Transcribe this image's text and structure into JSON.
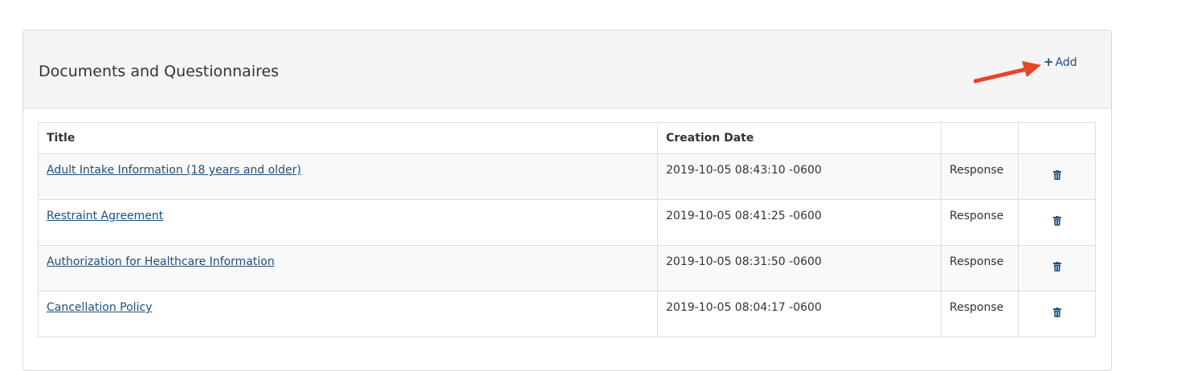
{
  "panel": {
    "title": "Documents and Questionnaires",
    "add_label": "Add",
    "add_icon": "plus-icon",
    "annotation_arrow_color": "#e8442a"
  },
  "table": {
    "columns": [
      "Title",
      "Creation Date",
      "",
      ""
    ],
    "rows": [
      {
        "title": "Adult Intake Information (18 years and older)",
        "date": "2019-10-05 08:43:10 -0600",
        "action": "Response",
        "delete_icon": "trash-icon"
      },
      {
        "title": "Restraint Agreement",
        "date": "2019-10-05 08:41:25 -0600",
        "action": "Response",
        "delete_icon": "trash-icon"
      },
      {
        "title": "Authorization for Healthcare Information",
        "date": "2019-10-05 08:31:50 -0600",
        "action": "Response",
        "delete_icon": "trash-icon"
      },
      {
        "title": "Cancellation Policy",
        "date": "2019-10-05 08:04:17 -0600",
        "action": "Response",
        "delete_icon": "trash-icon"
      }
    ]
  },
  "colors": {
    "link": "#1d4f7c",
    "header_bg": "#f5f5f5",
    "border": "#dddddd"
  }
}
